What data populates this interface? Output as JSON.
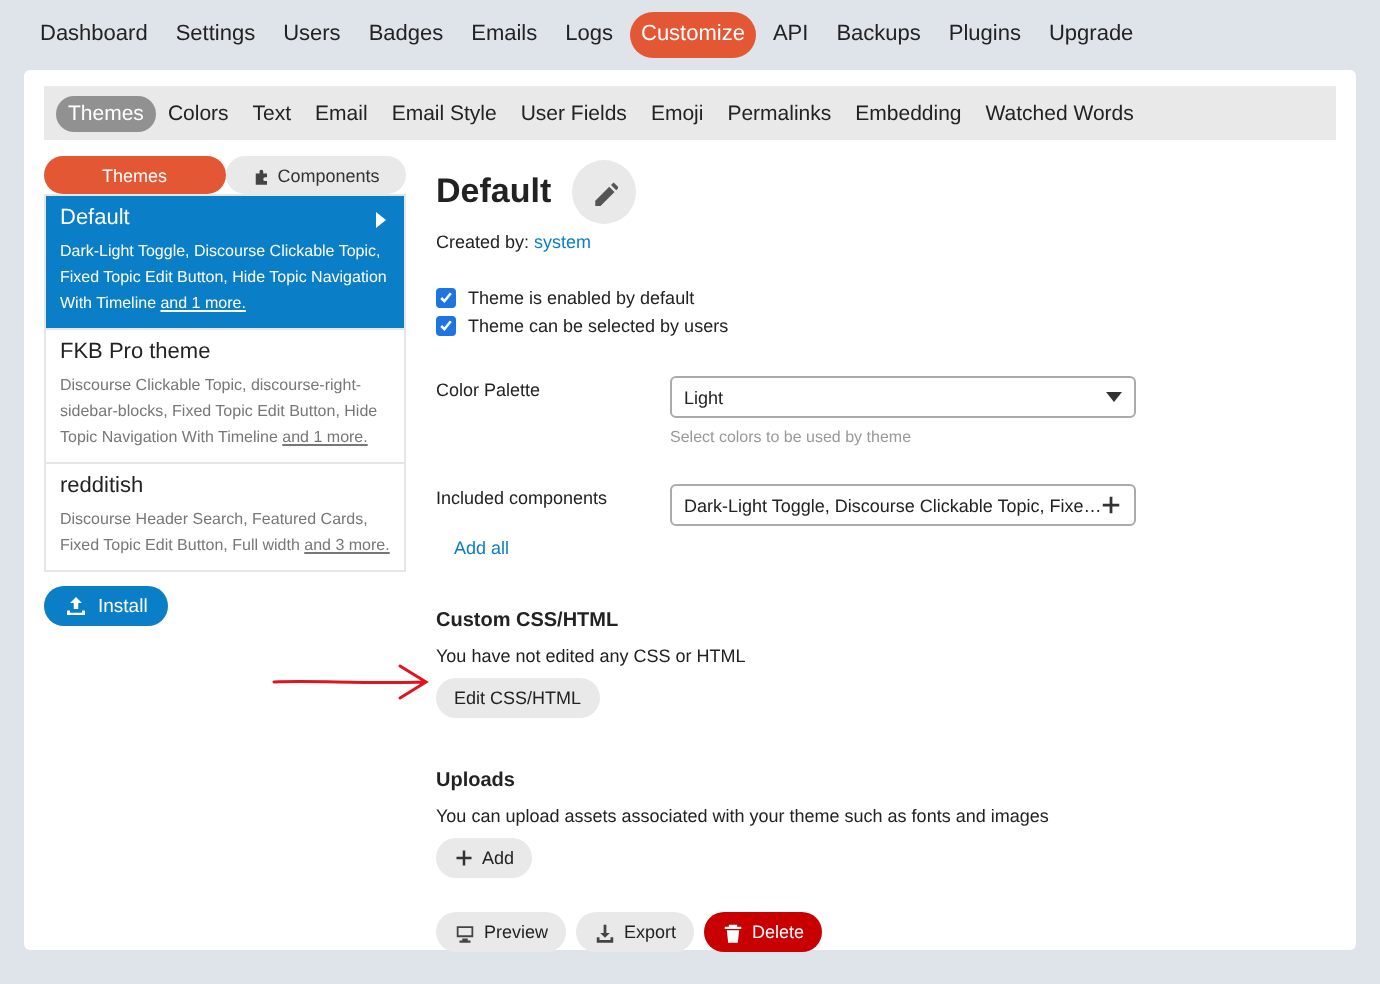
{
  "top_nav": [
    {
      "label": "Dashboard",
      "selected": false
    },
    {
      "label": "Settings",
      "selected": false
    },
    {
      "label": "Users",
      "selected": false
    },
    {
      "label": "Badges",
      "selected": false
    },
    {
      "label": "Emails",
      "selected": false
    },
    {
      "label": "Logs",
      "selected": false
    },
    {
      "label": "Customize",
      "selected": true
    },
    {
      "label": "API",
      "selected": false
    },
    {
      "label": "Backups",
      "selected": false
    },
    {
      "label": "Plugins",
      "selected": false
    },
    {
      "label": "Upgrade",
      "selected": false
    }
  ],
  "sub_nav": [
    {
      "label": "Themes",
      "selected": true
    },
    {
      "label": "Colors",
      "selected": false
    },
    {
      "label": "Text",
      "selected": false
    },
    {
      "label": "Email",
      "selected": false
    },
    {
      "label": "Email Style",
      "selected": false
    },
    {
      "label": "User Fields",
      "selected": false
    },
    {
      "label": "Emoji",
      "selected": false
    },
    {
      "label": "Permalinks",
      "selected": false
    },
    {
      "label": "Embedding",
      "selected": false
    },
    {
      "label": "Watched Words",
      "selected": false
    }
  ],
  "list_toggle": [
    {
      "label": "Themes",
      "selected": true,
      "kind": "themes"
    },
    {
      "label": "Components",
      "selected": false,
      "kind": "components"
    }
  ],
  "themes": [
    {
      "name": "Default",
      "description": "Dark-Light Toggle, Discourse Clickable Topic, Fixed Topic Edit Button, Hide Topic Navigation With Timeline",
      "more": "and 1 more.",
      "selected": true
    },
    {
      "name": "FKB Pro theme",
      "description": "Discourse Clickable Topic, discourse-right-sidebar-blocks, Fixed Topic Edit Button, Hide Topic Navigation With Timeline",
      "more": "and 1 more.",
      "selected": false
    },
    {
      "name": "redditish",
      "description": "Discourse Header Search, Featured Cards, Fixed Topic Edit Button, Full width",
      "more": "and 3 more.",
      "selected": false
    }
  ],
  "install_button": "Install",
  "detail": {
    "title": "Default",
    "created_by_label": "Created by:",
    "created_by": "system",
    "checkboxes": [
      {
        "label": "Theme is enabled by default",
        "checked": true
      },
      {
        "label": "Theme can be selected by users",
        "checked": true
      }
    ],
    "color_palette": {
      "label": "Color Palette",
      "value": "Light",
      "hint": "Select colors to be used by theme"
    },
    "included_components": {
      "label": "Included components",
      "value": "Dark-Light Toggle, Discourse Clickable Topic, Fixe…",
      "add_all": "Add all"
    },
    "custom_css": {
      "heading": "Custom CSS/HTML",
      "text": "You have not edited any CSS or HTML",
      "button": "Edit CSS/HTML"
    },
    "uploads": {
      "heading": "Uploads",
      "text": "You can upload assets associated with your theme such as fonts and images",
      "button": "Add"
    },
    "actions": [
      {
        "label": "Preview",
        "kind": "preview"
      },
      {
        "label": "Export",
        "kind": "export"
      },
      {
        "label": "Delete",
        "kind": "delete"
      }
    ]
  }
}
